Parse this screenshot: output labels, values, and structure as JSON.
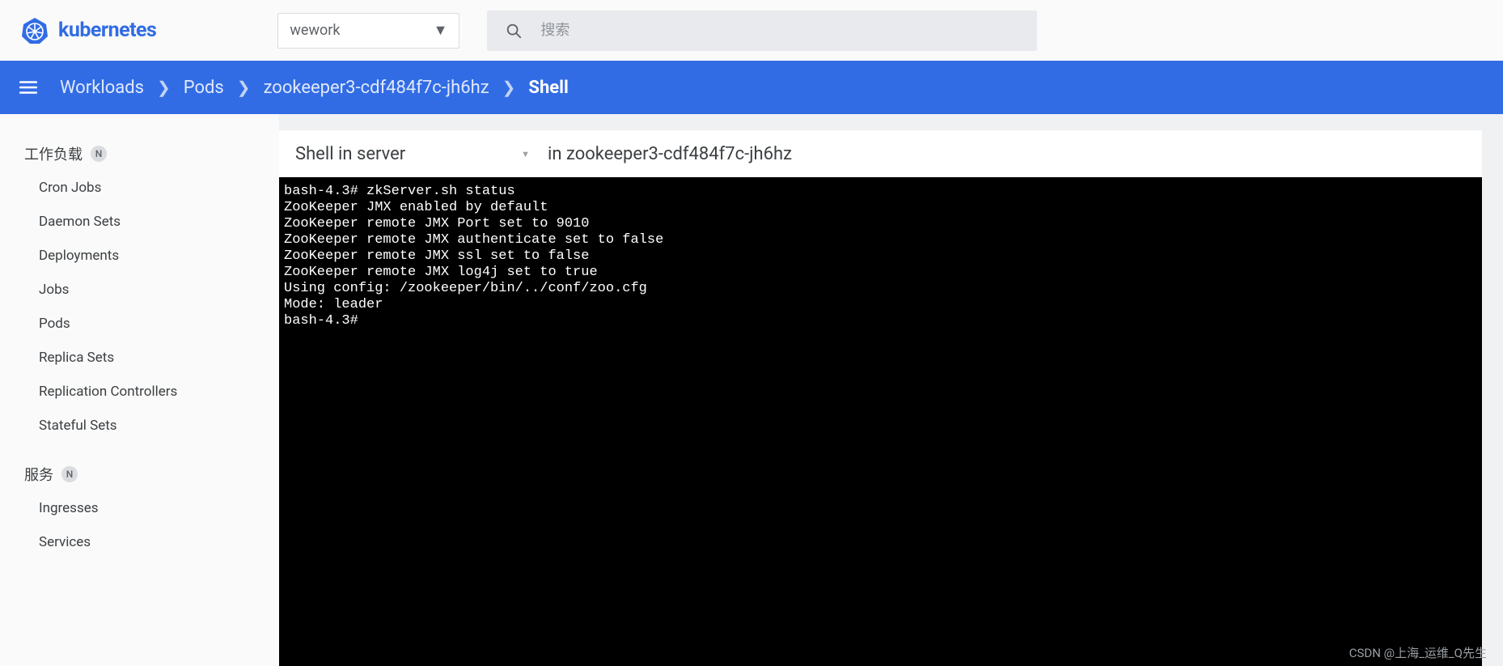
{
  "header": {
    "logo_text": "kubernetes",
    "namespace_selected": "wework",
    "search_placeholder": "搜索"
  },
  "breadcrumb": {
    "items": [
      "Workloads",
      "Pods",
      "zookeeper3-cdf484f7c-jh6hz"
    ],
    "current": "Shell"
  },
  "sidebar": {
    "groups": [
      {
        "title": "工作负载",
        "badge": "N",
        "items": [
          "Cron Jobs",
          "Daemon Sets",
          "Deployments",
          "Jobs",
          "Pods",
          "Replica Sets",
          "Replication Controllers",
          "Stateful Sets"
        ]
      },
      {
        "title": "服务",
        "badge": "N",
        "items": [
          "Ingresses",
          "Services"
        ]
      }
    ]
  },
  "shell": {
    "title": "Shell in server",
    "in_label": "in zookeeper3-cdf484f7c-jh6hz",
    "terminal_text": "bash-4.3# zkServer.sh status\nZooKeeper JMX enabled by default\nZooKeeper remote JMX Port set to 9010\nZooKeeper remote JMX authenticate set to false\nZooKeeper remote JMX ssl set to false\nZooKeeper remote JMX log4j set to true\nUsing config: /zookeeper/bin/../conf/zoo.cfg\nMode: leader\nbash-4.3#"
  },
  "watermark": "CSDN @上海_运维_Q先生"
}
